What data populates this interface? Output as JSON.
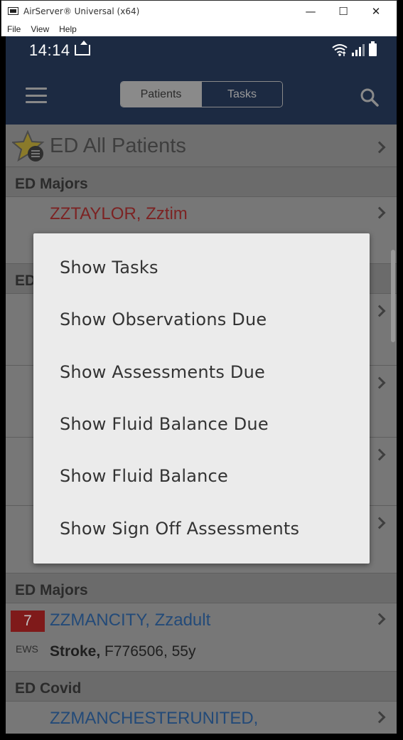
{
  "window": {
    "title": "AirServer® Universal (x64)",
    "minimize_glyph": "—",
    "maximize_glyph": "☐",
    "close_glyph": "✕",
    "menu": [
      "File",
      "View",
      "Help"
    ]
  },
  "statusbar": {
    "time": "14:14",
    "icons": [
      "notification-icon",
      "wifi-icon",
      "signal-icon",
      "battery-icon"
    ]
  },
  "appbar": {
    "tabs": [
      {
        "label": "Patients",
        "active": true
      },
      {
        "label": "Tasks",
        "active": false
      }
    ],
    "icons": [
      "menu-icon",
      "search-icon"
    ]
  },
  "list": {
    "all_patients_label": "ED All Patients",
    "sections": [
      {
        "header": "ED Majors",
        "patients": [
          {
            "name": "ZZTAYLOR, Zztim"
          }
        ]
      },
      {
        "header": "ED",
        "patients": []
      },
      {
        "header": "ED Majors",
        "patients": [
          {
            "name": "ZZMANCITY, Zzadult",
            "ews": "7",
            "ews_label": "EWS",
            "condition": "Stroke,",
            "details": "F776506, 55y"
          }
        ]
      },
      {
        "header": "ED Covid",
        "patients": [
          {
            "name": "ZZMANCHESTERUNITED,"
          }
        ]
      }
    ]
  },
  "popup_menu": {
    "items": [
      "Show Tasks",
      "Show Observations Due",
      "Show Assessments Due",
      "Show Fluid Balance Due",
      "Show Fluid Balance",
      "Show Sign Off Assessments"
    ]
  },
  "colors": {
    "appbar": "#1c2a42",
    "ews_badge": "#7f1a1a",
    "name_red": "#7c2323",
    "name_blue": "#234a78"
  }
}
